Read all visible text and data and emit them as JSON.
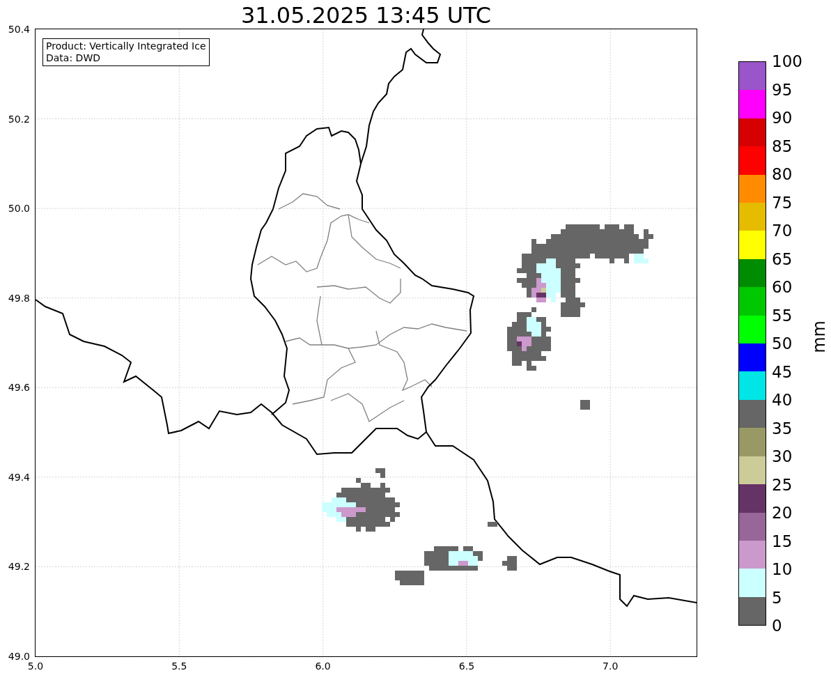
{
  "title": "31.05.2025 13:45 UTC",
  "map": {
    "info": [
      "Product: Vertically Integrated Ice",
      "Data: DWD"
    ],
    "xticks": [
      "5.0",
      "5.5",
      "6.0",
      "6.5",
      "7.0"
    ],
    "yticks": [
      "50.4",
      "50.2",
      "50.0",
      "49.8",
      "49.6",
      "49.4",
      "49.2",
      "49.0"
    ]
  },
  "colorbar": {
    "label": "mm",
    "ticks": [
      "100",
      "95",
      "90",
      "85",
      "80",
      "75",
      "70",
      "65",
      "60",
      "55",
      "50",
      "45",
      "40",
      "35",
      "30",
      "25",
      "20",
      "15",
      "10",
      "5",
      "0"
    ],
    "bins": [
      {
        "color": "#9955c9"
      },
      {
        "color": "#ff00ff"
      },
      {
        "color": "#d70000"
      },
      {
        "color": "#ff0000"
      },
      {
        "color": "#ff8c00"
      },
      {
        "color": "#e5bc00"
      },
      {
        "color": "#ffff00"
      },
      {
        "color": "#008c00"
      },
      {
        "color": "#00c800"
      },
      {
        "color": "#00ff00"
      },
      {
        "color": "#0000ff"
      },
      {
        "color": "#00e5e5"
      },
      {
        "color": "#666666"
      },
      {
        "color": "#999966"
      },
      {
        "color": "#cccc99"
      },
      {
        "color": "#663366"
      },
      {
        "color": "#996699"
      },
      {
        "color": "#cc99cc"
      },
      {
        "color": "#ccffff"
      },
      {
        "color": "#666666"
      }
    ]
  }
}
